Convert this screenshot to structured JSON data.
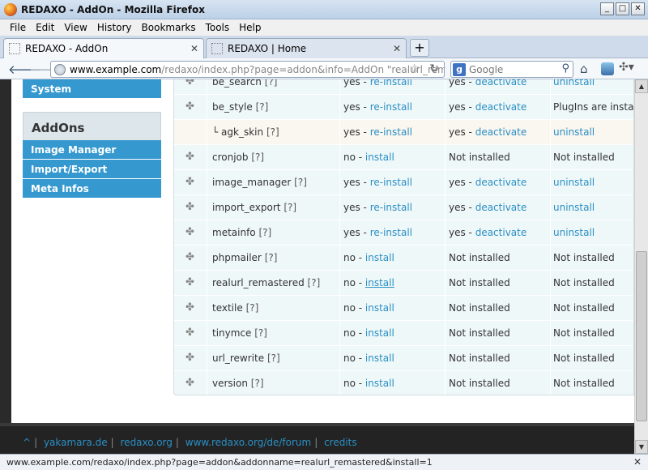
{
  "window": {
    "title": "REDAXO - AddOn - Mozilla Firefox"
  },
  "menu": [
    "File",
    "Edit",
    "View",
    "History",
    "Bookmarks",
    "Tools",
    "Help"
  ],
  "tabs": [
    {
      "label": "REDAXO - AddOn",
      "active": true
    },
    {
      "label": "REDAXO | Home",
      "active": false
    }
  ],
  "url": {
    "domain": "www.example.com",
    "path": "/redaxo/index.php?page=addon&info=AddOn \"realurl_remaster"
  },
  "search": {
    "engine": "Google",
    "placeholder": "Google"
  },
  "sidebar": {
    "system_label": "System",
    "addons_heading": "AddOns",
    "items": [
      "Image Manager",
      "Import/Export",
      "Meta Infos"
    ]
  },
  "addons": [
    {
      "name": "be_search",
      "help": "[?]",
      "installed": "yes - ",
      "install_link": "re-install",
      "activated": "yes - ",
      "activate_link": "deactivate",
      "delete": "uninstall",
      "delete_is_link": true
    },
    {
      "name": "be_style",
      "help": "[?]",
      "installed": "yes - ",
      "install_link": "re-install",
      "activated": "yes - ",
      "activate_link": "deactivate",
      "delete": "PlugIns are install",
      "delete_is_link": false
    },
    {
      "name": "└ agk_skin",
      "help": "[?]",
      "installed": "yes - ",
      "install_link": "re-install",
      "activated": "yes - ",
      "activate_link": "deactivate",
      "delete": "uninstall",
      "delete_is_link": true,
      "plugin": true
    },
    {
      "name": "cronjob",
      "help": "[?]",
      "installed": "no - ",
      "install_link": "install",
      "activated": "Not installed",
      "activate_link": "",
      "delete": "Not installed",
      "delete_is_link": false
    },
    {
      "name": "image_manager",
      "help": "[?]",
      "installed": "yes - ",
      "install_link": "re-install",
      "activated": "yes - ",
      "activate_link": "deactivate",
      "delete": "uninstall",
      "delete_is_link": true
    },
    {
      "name": "import_export",
      "help": "[?]",
      "installed": "yes - ",
      "install_link": "re-install",
      "activated": "yes - ",
      "activate_link": "deactivate",
      "delete": "uninstall",
      "delete_is_link": true
    },
    {
      "name": "metainfo",
      "help": "[?]",
      "installed": "yes - ",
      "install_link": "re-install",
      "activated": "yes - ",
      "activate_link": "deactivate",
      "delete": "uninstall",
      "delete_is_link": true
    },
    {
      "name": "phpmailer",
      "help": "[?]",
      "installed": "no - ",
      "install_link": "install",
      "activated": "Not installed",
      "activate_link": "",
      "delete": "Not installed",
      "delete_is_link": false
    },
    {
      "name": "realurl_remastered",
      "help": "[?]",
      "installed": "no - ",
      "install_link": "install",
      "activated": "Not installed",
      "activate_link": "",
      "delete": "Not installed",
      "delete_is_link": false,
      "hovered": true
    },
    {
      "name": "textile",
      "help": "[?]",
      "installed": "no - ",
      "install_link": "install",
      "activated": "Not installed",
      "activate_link": "",
      "delete": "Not installed",
      "delete_is_link": false
    },
    {
      "name": "tinymce",
      "help": "[?]",
      "installed": "no - ",
      "install_link": "install",
      "activated": "Not installed",
      "activate_link": "",
      "delete": "Not installed",
      "delete_is_link": false
    },
    {
      "name": "url_rewrite",
      "help": "[?]",
      "installed": "no - ",
      "install_link": "install",
      "activated": "Not installed",
      "activate_link": "",
      "delete": "Not installed",
      "delete_is_link": false
    },
    {
      "name": "version",
      "help": "[?]",
      "installed": "no - ",
      "install_link": "install",
      "activated": "Not installed",
      "activate_link": "",
      "delete": "Not installed",
      "delete_is_link": false
    }
  ],
  "footer": {
    "caret": "^",
    "links": [
      "yakamara.de",
      "redaxo.org",
      "www.redaxo.org/de/forum",
      "credits"
    ]
  },
  "status": {
    "text": "www.example.com/redaxo/index.php?page=addon&addonname=realurl_remastered&install=1"
  },
  "colors": {
    "accent": "#3599d0",
    "link": "#2a8fc4",
    "row_bg": "#eff8f9",
    "row_alt": "#faf6f0"
  }
}
